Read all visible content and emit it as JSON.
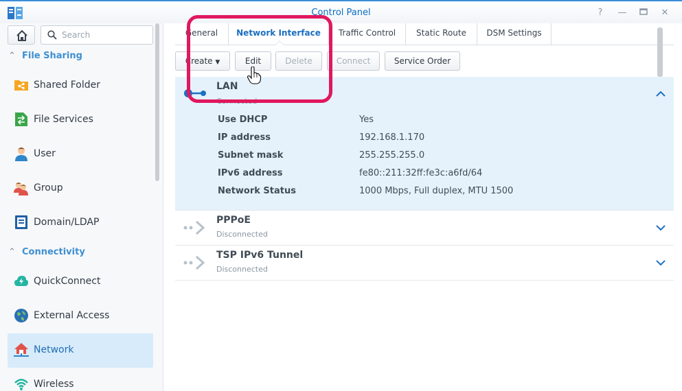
{
  "window": {
    "title": "Control Panel",
    "help_icon": "help-icon",
    "min_icon": "minimize-icon",
    "max_icon": "maximize-icon",
    "close_icon": "close-icon"
  },
  "sidebar": {
    "search_placeholder": "Search",
    "sections": [
      {
        "label": "File Sharing"
      },
      {
        "label": "Connectivity"
      }
    ],
    "items": [
      {
        "label": "Shared Folder",
        "icon": "shared-folder-icon"
      },
      {
        "label": "File Services",
        "icon": "file-services-icon"
      },
      {
        "label": "User",
        "icon": "user-icon"
      },
      {
        "label": "Group",
        "icon": "group-icon"
      },
      {
        "label": "Domain/LDAP",
        "icon": "domain-ldap-icon"
      },
      {
        "label": "QuickConnect",
        "icon": "quickconnect-icon"
      },
      {
        "label": "External Access",
        "icon": "external-access-icon"
      },
      {
        "label": "Network",
        "icon": "network-icon",
        "active": true
      },
      {
        "label": "Wireless",
        "icon": "wireless-icon"
      }
    ]
  },
  "tabs": [
    {
      "label": "General"
    },
    {
      "label": "Network Interface",
      "active": true
    },
    {
      "label": "Traffic Control"
    },
    {
      "label": "Static Route"
    },
    {
      "label": "DSM Settings"
    }
  ],
  "toolbar": {
    "create": "Create",
    "edit": "Edit",
    "delete": "Delete",
    "connect": "Connect",
    "service_order": "Service Order"
  },
  "interfaces": [
    {
      "name": "LAN",
      "status": "Connected",
      "details": [
        {
          "key": "Use DHCP",
          "value": "Yes"
        },
        {
          "key": "IP address",
          "value": "192.168.1.170"
        },
        {
          "key": "Subnet mask",
          "value": "255.255.255.0"
        },
        {
          "key": "IPv6 address",
          "value": "fe80::211:32ff:fe3c:a6fd/64"
        },
        {
          "key": "Network Status",
          "value": "1000 Mbps, Full duplex, MTU 1500"
        }
      ]
    },
    {
      "name": "PPPoE",
      "status": "Disconnected"
    },
    {
      "name": "TSP IPv6 Tunnel",
      "status": "Disconnected"
    }
  ],
  "colors": {
    "accent": "#1b6fc1",
    "highlight": "#e0185e",
    "expanded_bg": "#e5f2fc"
  }
}
